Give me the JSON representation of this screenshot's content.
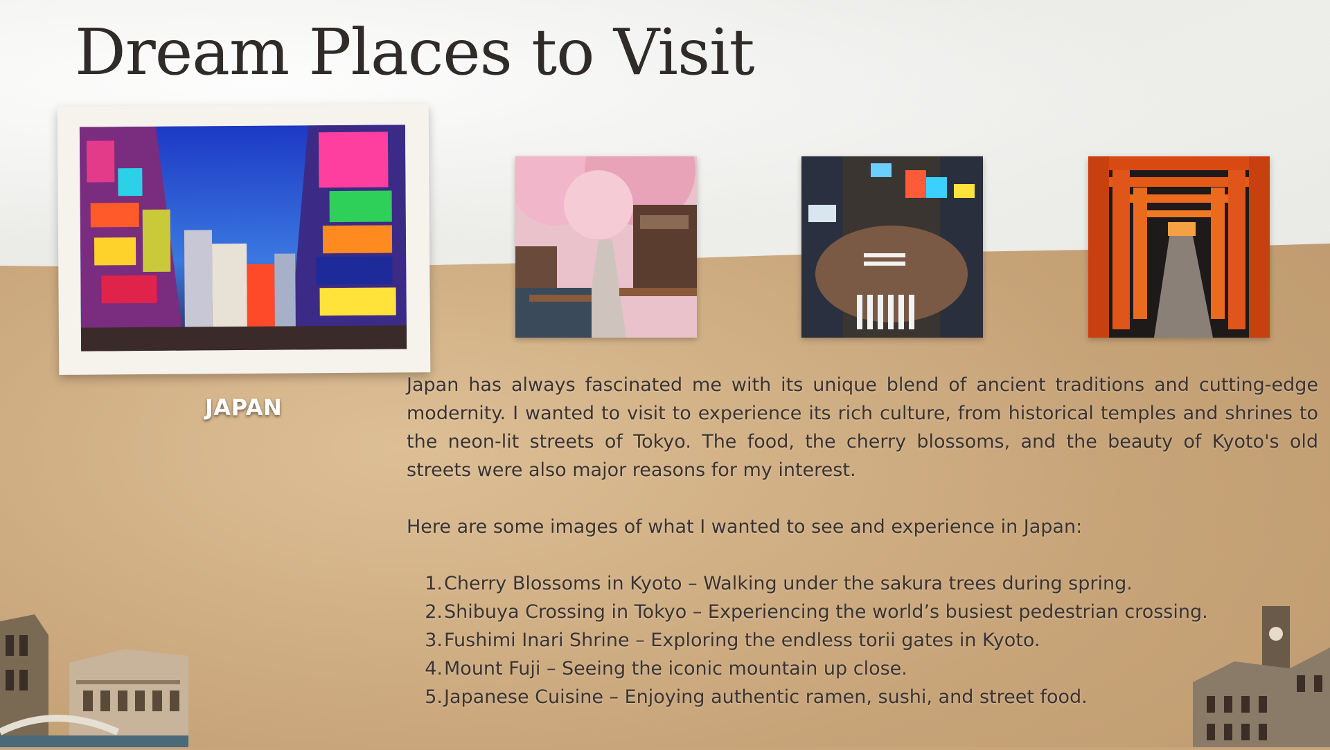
{
  "page": {
    "title": "Dream Places to Visit"
  },
  "featured": {
    "photo_icon": "akihabara-photo-icon",
    "caption": "JAPAN"
  },
  "gallery": [
    {
      "icon": "cherry-blossoms-photo-icon"
    },
    {
      "icon": "shibuya-crossing-photo-icon"
    },
    {
      "icon": "torii-gates-photo-icon"
    }
  ],
  "body": {
    "intro": "Japan has always fascinated me with its unique blend of ancient traditions and cutting-edge modernity. I wanted to visit to experience its rich culture, from historical temples and shrines to the neon-lit streets of Tokyo. The food, the cherry blossoms, and the beauty of Kyoto's old streets were also major reasons for my interest.",
    "lead": "Here are some images of what I wanted to see and experience in Japan:",
    "items": [
      {
        "num": "1.",
        "text": "Cherry Blossoms in Kyoto – Walking under the sakura trees during spring."
      },
      {
        "num": "2.",
        "text": "Shibuya Crossing in Tokyo – Experiencing the world’s busiest pedestrian crossing."
      },
      {
        "num": "3.",
        "text": "Fushimi Inari Shrine – Exploring the endless torii gates in Kyoto."
      },
      {
        "num": "4.",
        "text": "Mount Fuji – Seeing the iconic mountain up close."
      },
      {
        "num": "5.",
        "text": "Japanese Cuisine – Enjoying authentic ramen, sushi, and street food."
      }
    ]
  },
  "decorations": {
    "left": "venice-buildings-cutout-icon",
    "right": "clock-tower-building-cutout-icon"
  },
  "colors": {
    "paper_top": "#efefec",
    "paper_bottom": "#c9a57c",
    "title_text": "#2f2b28",
    "body_text": "#3a3330",
    "caption_text": "#ffffff"
  }
}
